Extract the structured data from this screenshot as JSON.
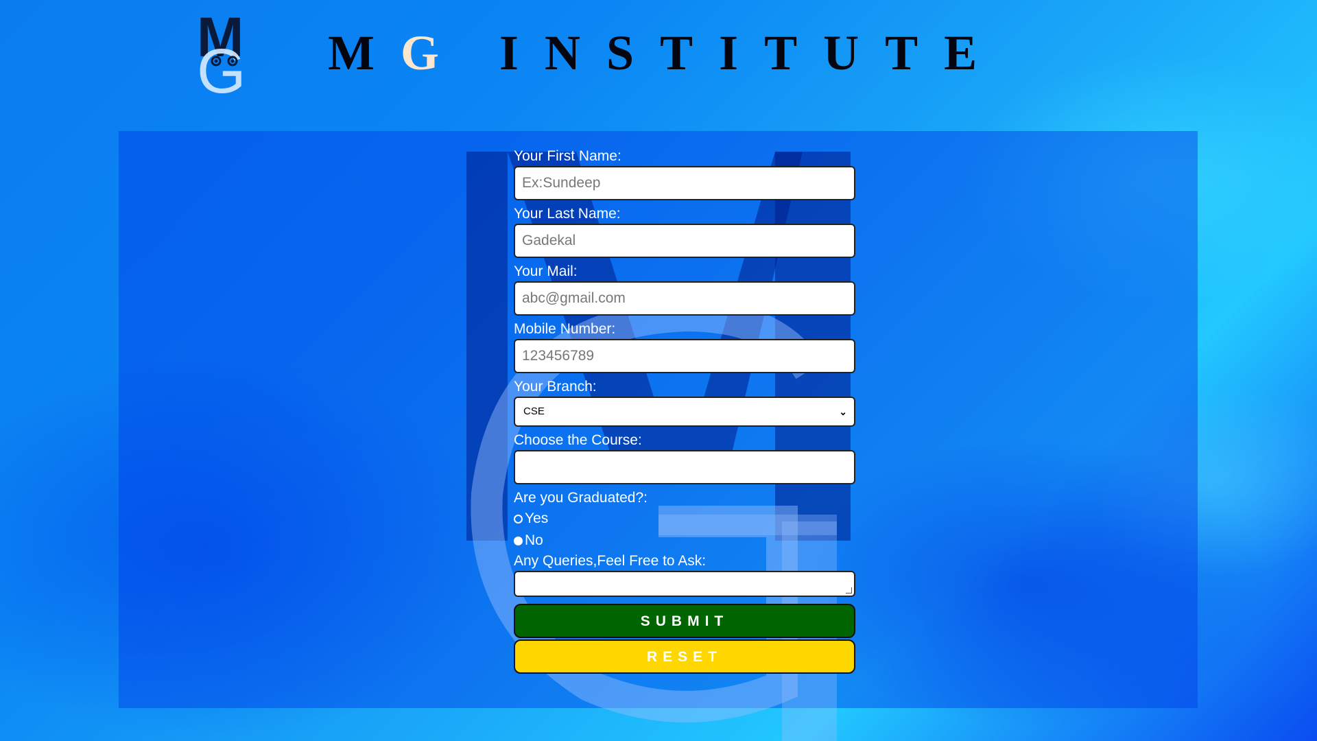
{
  "header": {
    "logo": {
      "letter_top": "M",
      "letter_bottom": "G"
    },
    "title": {
      "m": "M",
      "g": "G",
      "rest": "INSTITUTE"
    }
  },
  "form": {
    "first_name": {
      "label": "Your First Name:",
      "placeholder": "Ex:Sundeep"
    },
    "last_name": {
      "label": "Your Last Name:",
      "placeholder": "Gadekal"
    },
    "mail": {
      "label": "Your Mail:",
      "placeholder": "abc@gmail.com"
    },
    "mobile": {
      "label": "Mobile Number:",
      "placeholder": "123456789"
    },
    "branch": {
      "label": "Your Branch:",
      "selected": "CSE"
    },
    "course": {
      "label": "Choose the Course:",
      "value": ""
    },
    "graduated": {
      "label": "Are you Graduated?:",
      "options": [
        {
          "label": "Yes",
          "checked": false
        },
        {
          "label": "No",
          "checked": true
        }
      ]
    },
    "queries": {
      "label": "Any Queries,Feel Free to Ask:",
      "value": ""
    },
    "submit_label": "SUBMIT",
    "reset_label": "RESET"
  },
  "colors": {
    "submit_bg": "#006400",
    "reset_bg": "#ffd700",
    "panel_bg": "#0a4ef0",
    "title_accent": "#fbe6cf"
  }
}
